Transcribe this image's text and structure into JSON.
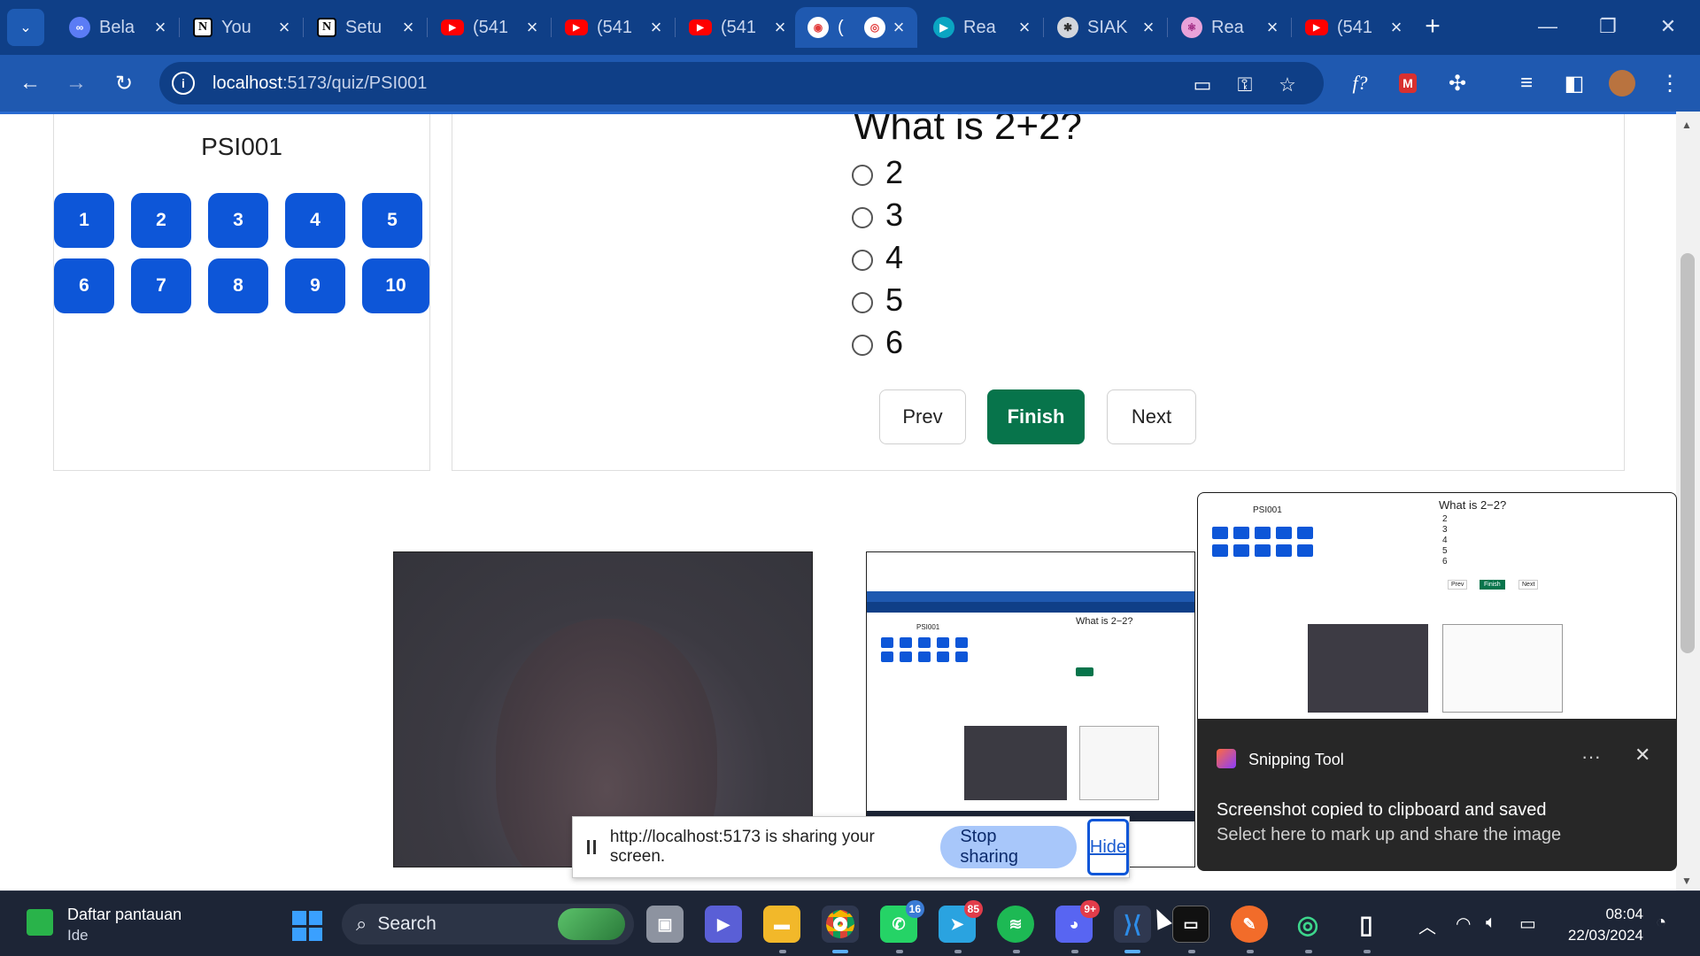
{
  "browser": {
    "tabs": [
      {
        "title": "Bela",
        "icon": "meta-icon"
      },
      {
        "title": "You",
        "icon": "notion-icon"
      },
      {
        "title": "Setu",
        "icon": "notion-icon"
      },
      {
        "title": "(541",
        "icon": "youtube-icon"
      },
      {
        "title": "(541",
        "icon": "youtube-icon"
      },
      {
        "title": "(541",
        "icon": "youtube-icon"
      },
      {
        "title": "(",
        "icon": "recording-icon",
        "active": true
      },
      {
        "title": "Rea",
        "icon": "play-icon"
      },
      {
        "title": "SIAK",
        "icon": "seal-icon"
      },
      {
        "title": "Rea",
        "icon": "react-icon"
      },
      {
        "title": "(541",
        "icon": "youtube-icon"
      }
    ],
    "url_host": "localhost",
    "url_path": ":5173/quiz/PSI001",
    "accent": "#1f59b0"
  },
  "quiz": {
    "id": "PSI001",
    "numbers": [
      "1",
      "2",
      "3",
      "4",
      "5",
      "6",
      "7",
      "8",
      "9",
      "10"
    ],
    "question": "What is 2+2?",
    "options": [
      "2",
      "3",
      "4",
      "5",
      "6"
    ],
    "buttons": {
      "prev": "Prev",
      "finish": "Finish",
      "next": "Next"
    },
    "finish_color": "#07744b",
    "number_color": "#0d56d8"
  },
  "preview": {
    "question": "What is 2−2?",
    "id": "PSI001",
    "options": [
      "2",
      "3",
      "4",
      "5",
      "6"
    ],
    "finish": "Finish",
    "prev": "Prev",
    "next": "Next"
  },
  "sharing": {
    "message": "http://localhost:5173 is sharing your screen.",
    "stop": "Stop sharing",
    "hide": "Hide"
  },
  "notification": {
    "app": "Snipping Tool",
    "more": "···",
    "close": "✕",
    "line1": "Screenshot copied to clipboard and saved",
    "line2": "Select here to mark up and share the image"
  },
  "taskbar": {
    "weather_title": "Daftar pantauan",
    "weather_sub": "Ide",
    "search": "Search",
    "whatsapp_badge": "16",
    "telegram_badge": "85",
    "discord_badge": "9+",
    "time": "08:04",
    "date": "22/03/2024"
  }
}
